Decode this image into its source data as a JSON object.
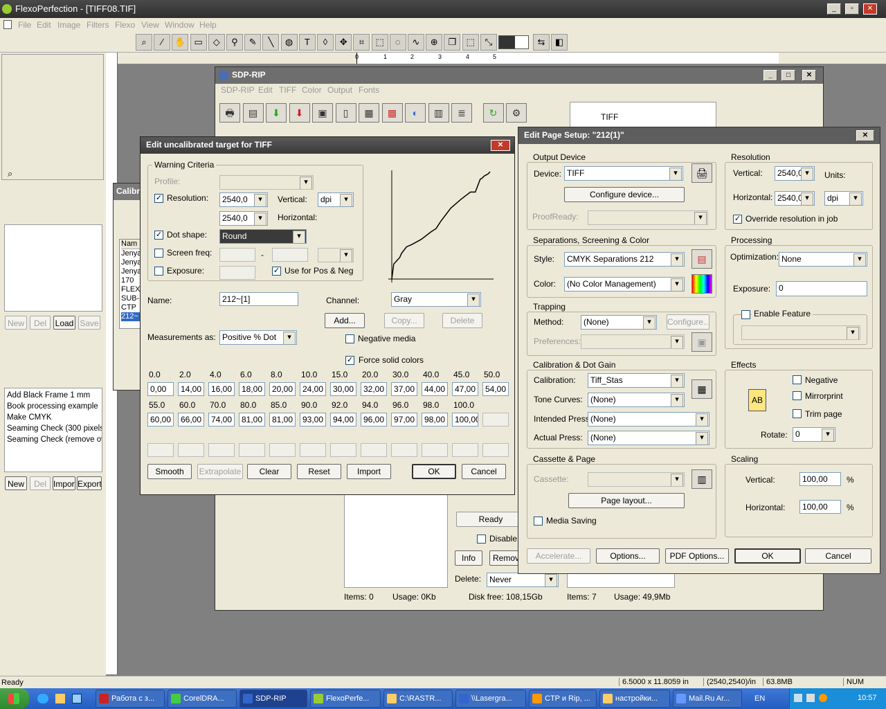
{
  "main_window": {
    "title": "FlexoPerfection - [TIFF08.TIF]",
    "menu": [
      "File",
      "Edit",
      "Image",
      "Filters",
      "Flexo",
      "View",
      "Window",
      "Help"
    ],
    "tools": [
      "magnifier-icon",
      "wand-icon",
      "hand-icon",
      "ruler-icon",
      "eraser-icon",
      "stamp-icon",
      "pencil-icon",
      "line-icon",
      "fill-icon",
      "text-icon",
      "shape-icon",
      "move-icon",
      "crop-icon",
      "rect-select-icon",
      "ellipse-select-icon",
      "lasso-icon",
      "zoom-tool-icon",
      "clone-icon",
      "marquee-icon",
      "transform-icon"
    ],
    "status": "Ready",
    "status_fields": [
      "6.5000 x 11.8059 in",
      "(2540,2540)/in",
      "63.8MB",
      "NUM"
    ],
    "ruler_labels": [
      "0",
      "1",
      "2",
      "3",
      "4",
      "5",
      "6"
    ]
  },
  "left_panel": {
    "top_buttons": [
      "New",
      "Del",
      "Load",
      "Save"
    ],
    "actions": [
      "Add Black Frame 1 mm",
      "Book processing example",
      "Make CMYK",
      "Seaming Check (300 pixels c",
      "Seaming Check (remove ove"
    ],
    "bottom_buttons": [
      "New",
      "Del",
      "Import",
      "Export"
    ]
  },
  "calib_bg": {
    "title": "Calibr",
    "col": "Nam",
    "items": [
      "Jenya",
      "Jenya",
      "Jenya",
      "170",
      "FLEX",
      "SUB-",
      "CTP",
      "212~"
    ]
  },
  "sdp_rip": {
    "title": "SDP-RIP",
    "menu": [
      "SDP-RIP",
      "Edit",
      "TIFF",
      "Color",
      "Output",
      "Fonts"
    ],
    "tiff_label": "TIFF",
    "ready": "Ready",
    "disable": "Disable c",
    "info": "Info",
    "remove": "Remov",
    "delete_label": "Delete:",
    "delete_value": "Never",
    "footer": {
      "items1": "Items: 0",
      "usage1": "Usage: 0Kb",
      "disk_free": "Disk free: 108,15Gb",
      "items2": "Items: 7",
      "usage2": "Usage: 49,9Mb"
    }
  },
  "edit_target": {
    "title": "Edit uncalibrated target for TIFF",
    "warning_group": "Warning Criteria",
    "profile_label": "Profile:",
    "resolution_label": "Resolution:",
    "res_value1": "2540,0",
    "res_value2": "2540,0",
    "vertical_label": "Vertical:",
    "horizontal_label": "Horizontal:",
    "units": "dpi",
    "dot_shape_label": "Dot shape:",
    "dot_shape_value": "Round",
    "screen_freq_label": "Screen freq:",
    "screen_dash": "-",
    "exposure_label": "Exposure:",
    "use_pos_neg": "Use for Pos & Neg",
    "name_label": "Name:",
    "name_value": "212~[1]",
    "channel_label": "Channel:",
    "channel_value": "Gray",
    "add": "Add...",
    "copy": "Copy...",
    "delete": "Delete",
    "measurements_label": "Measurements as:",
    "measurements_value": "Positive % Dot",
    "negative_media": "Negative media",
    "force_solid": "Force solid colors",
    "headers1": [
      "0.0",
      "2.0",
      "4.0",
      "6.0",
      "8.0",
      "10.0",
      "15.0",
      "20.0",
      "30.0",
      "40.0",
      "45.0",
      "50.0"
    ],
    "values1": [
      "0,00",
      "14,00",
      "16,00",
      "18,00",
      "20,00",
      "24,00",
      "30,00",
      "32,00",
      "37,00",
      "44,00",
      "47,00",
      "54,00"
    ],
    "headers2": [
      "55.0",
      "60.0",
      "70.0",
      "80.0",
      "85.0",
      "90.0",
      "92.0",
      "94.0",
      "96.0",
      "98.0",
      "100.0"
    ],
    "values2": [
      "60,00",
      "66,00",
      "74,00",
      "81,00",
      "81,00",
      "93,00",
      "94,00",
      "96,00",
      "97,00",
      "98,00",
      "100,00",
      ""
    ],
    "buttons": {
      "smooth": "Smooth",
      "extrapolate": "Extrapolate",
      "clear": "Clear",
      "reset": "Reset",
      "import": "Import",
      "ok": "OK",
      "cancel": "Cancel"
    }
  },
  "page_setup": {
    "title": "Edit Page Setup: \"212(1)\"",
    "output_device": "Output Device",
    "device_label": "Device:",
    "device_value": "TIFF",
    "configure_device": "Configure device...",
    "proofready": "ProofReady:",
    "separations_group": "Separations, Screening & Color",
    "style_label": "Style:",
    "style_value": "CMYK Separations 212",
    "color_label": "Color:",
    "color_value": "(No Color Management)",
    "trapping": "Trapping",
    "method_label": "Method:",
    "method_value": "(None)",
    "configure": "Configure...",
    "preferences": "Preferences:",
    "calib_group": "Calibration & Dot Gain",
    "calibration_label": "Calibration:",
    "calibration_value": "Tiff_Stas",
    "tone_label": "Tone Curves:",
    "tone_value": "(None)",
    "intended_label": "Intended Press:",
    "intended_value": "(None)",
    "actual_label": "Actual Press:",
    "actual_value": "(None)",
    "cassette_group": "Cassette & Page",
    "cassette_label": "Cassette:",
    "page_layout": "Page layout...",
    "media_saving": "Media Saving",
    "resolution": "Resolution",
    "vertical_label": "Vertical:",
    "vertical_value": "2540,0",
    "horizontal_label": "Horizontal:",
    "horizontal_value": "2540,0",
    "units_label": "Units:",
    "units_value": "dpi",
    "override": "Override resolution in job",
    "processing": "Processing",
    "optimization_label": "Optimization:",
    "optimization_value": "None",
    "exposure_label": "Exposure:",
    "exposure_value": "0",
    "enable_feature": "Enable Feature",
    "effects": "Effects",
    "ab": "AB",
    "negative": "Negative",
    "mirrorprint": "Mirrorprint",
    "trim": "Trim page",
    "rotate_label": "Rotate:",
    "rotate_value": "0",
    "scaling": "Scaling",
    "scale_v_label": "Vertical:",
    "scale_v": "100,00",
    "scale_h_label": "Horizontal:",
    "scale_h": "100,00",
    "percent": "%",
    "accelerate": "Accelerate...",
    "options": "Options...",
    "pdf_options": "PDF Options...",
    "ok": "OK",
    "cancel": "Cancel"
  },
  "taskbar": {
    "items": [
      "Работа с з...",
      "CorelDRA...",
      "SDP-RIP",
      "FlexoPerfe...",
      "C:\\RASTR...",
      "\\\\Lasergra...",
      "CTP и Rip, ...",
      "настройки...",
      "Mail.Ru Ar..."
    ],
    "lang": "EN",
    "clock": "10:57"
  }
}
